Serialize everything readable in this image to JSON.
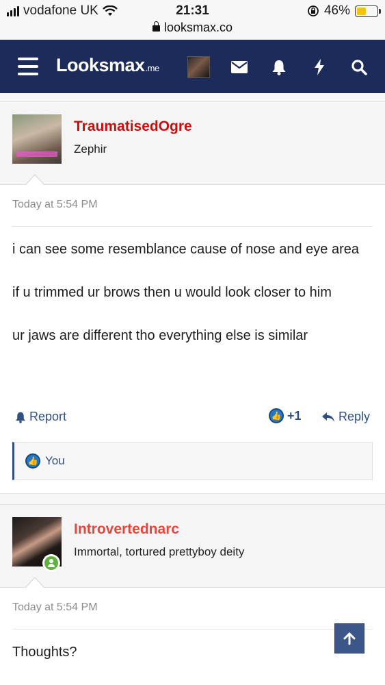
{
  "status_bar": {
    "carrier": "vodafone UK",
    "time": "21:31",
    "battery_percent": "46%",
    "battery_level": 0.46,
    "url": "looksmax.co"
  },
  "nav": {
    "logo_main": "Looksmax",
    "logo_tld": ".me",
    "icons": [
      "menu-icon",
      "avatar",
      "envelope-icon",
      "bell-icon",
      "bolt-icon",
      "search-icon"
    ]
  },
  "posts": [
    {
      "username": "TraumatisedOgre",
      "username_color": "#c70f0f",
      "user_title": "Zephir",
      "date": "Today at 5:54 PM",
      "body": [
        "i can see some resemblance cause of nose and eye area",
        "if u trimmed ur brows then u would look closer to him",
        "ur jaws are different tho everything else is similar"
      ],
      "report_label": "Report",
      "like_count": "+1",
      "reply_label": "Reply",
      "likes_summary": "You"
    },
    {
      "username": "Introvertednarc",
      "username_color": "#e8453c",
      "user_title": "Immortal, tortured prettyboy deity",
      "date": "Today at 5:54 PM",
      "body": [
        "Thoughts?"
      ]
    }
  ],
  "colors": {
    "navbar": "#1c2b5a",
    "link": "#2d4f85",
    "online": "#5db33b"
  }
}
